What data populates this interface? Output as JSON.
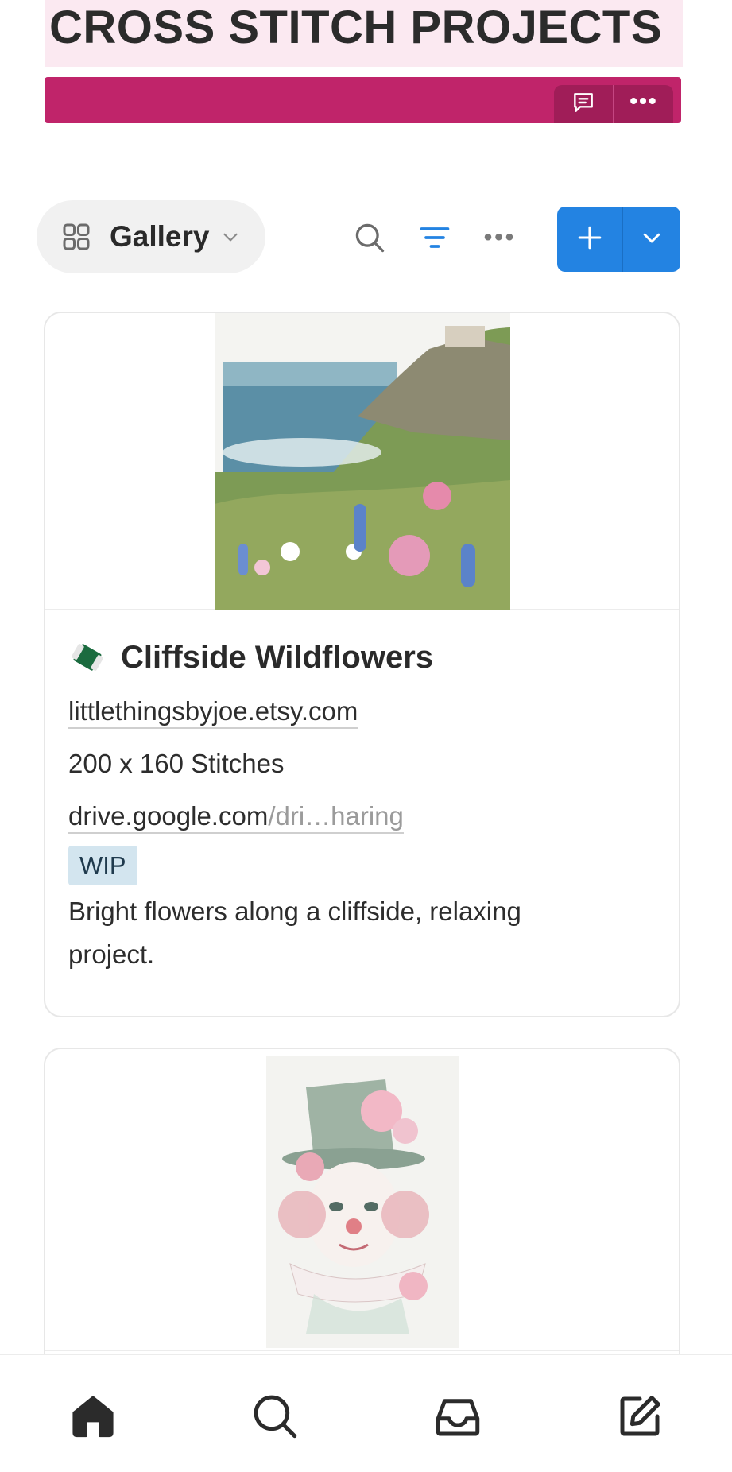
{
  "page": {
    "title": "CROSS STITCH PROJECTS",
    "banner_color": "#c0246a",
    "title_bg_color": "#fbe9f1"
  },
  "banner": {
    "actions": [
      {
        "icon": "comment-icon"
      },
      {
        "icon": "more-horizontal-icon",
        "label": "•••"
      }
    ]
  },
  "toolbar": {
    "view_label": "Gallery",
    "view_icon": "gallery-grid-icon",
    "search_icon": "search-icon",
    "filter_icon": "filter-icon",
    "more_label": "•••",
    "new_button_icon": "plus-icon",
    "new_menu_icon": "chevron-down-icon",
    "accent_color": "#2383e2"
  },
  "cards": [
    {
      "icon": "thread-spool-icon",
      "title": "Cliffside Wildflowers",
      "source_link": "littlethingsbyjoe.etsy.com",
      "size": "200 x 160 Stitches",
      "file_link_domain": "drive.google.com",
      "file_link_path": "/dri…haring",
      "status": "WIP",
      "status_color": "#d3e5ef",
      "description": "Bright flowers along a cliffside, relaxing project.",
      "cover": "coastal cliff landscape with wildflowers"
    },
    {
      "cover": "vintage clown portrait with floral top hat"
    }
  ],
  "bottom_nav": {
    "items": [
      {
        "icon": "home-icon"
      },
      {
        "icon": "search-icon"
      },
      {
        "icon": "inbox-icon"
      },
      {
        "icon": "compose-icon"
      }
    ]
  }
}
